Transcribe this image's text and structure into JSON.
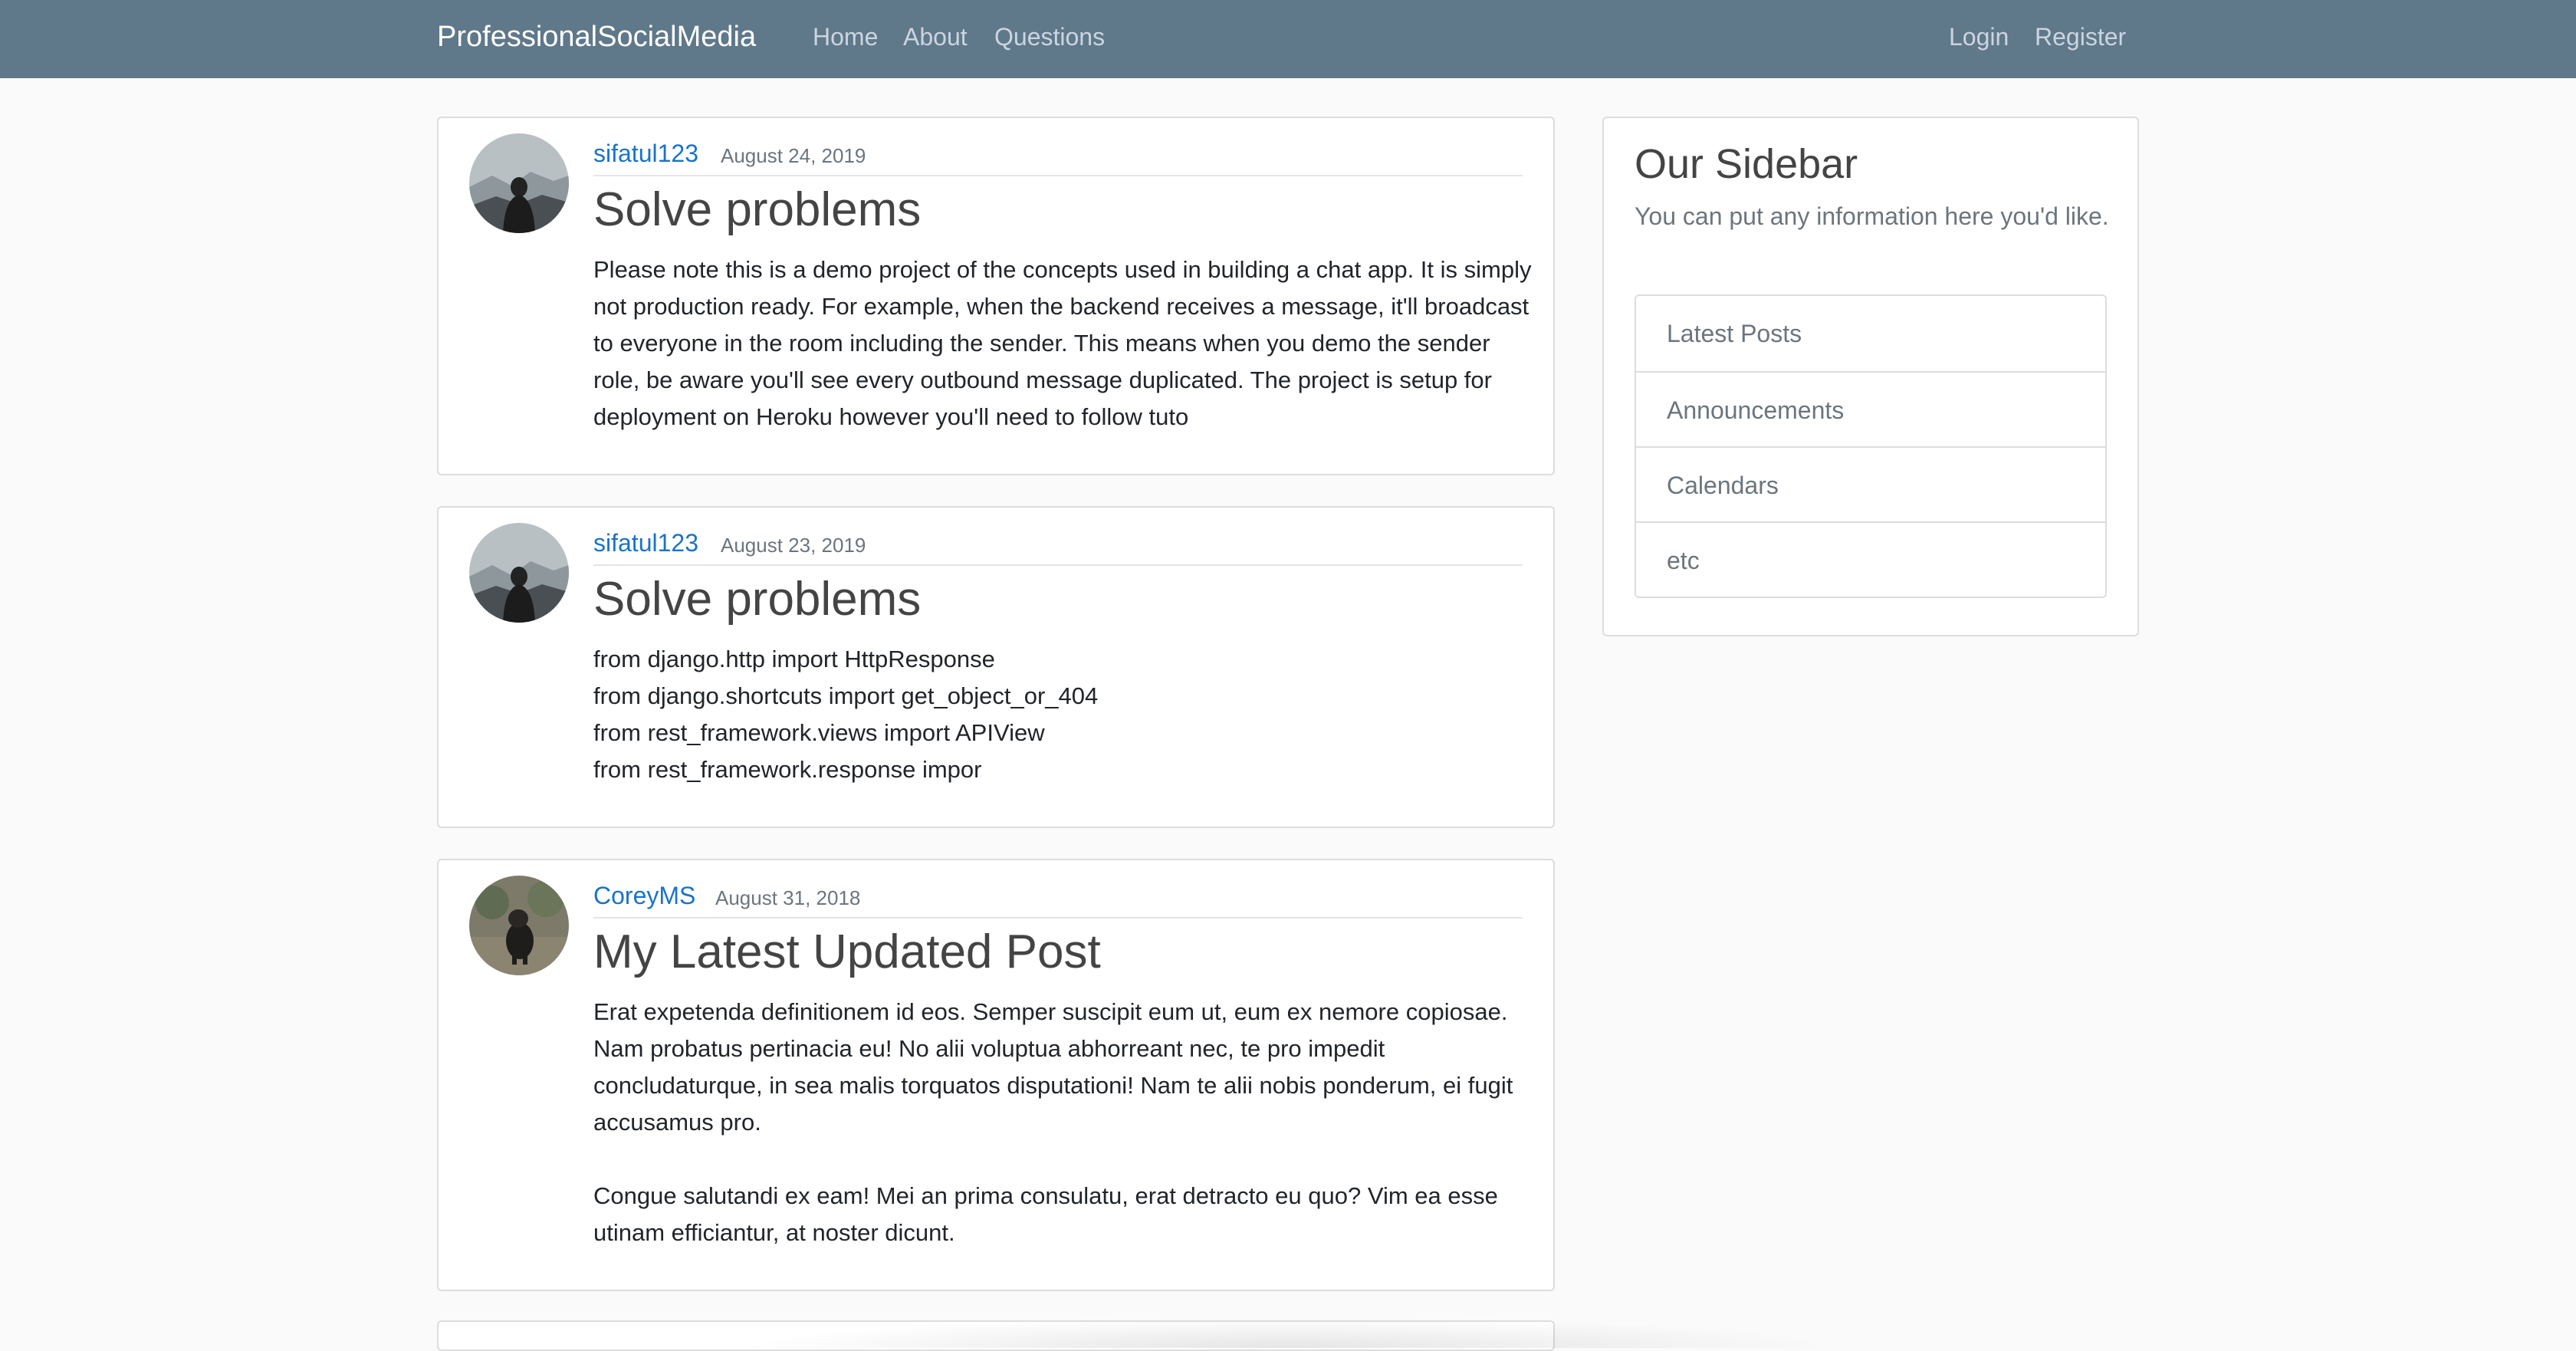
{
  "navbar": {
    "brand": "ProfessionalSocialMedia",
    "links": [
      "Home",
      "About",
      "Questions"
    ],
    "auth": [
      "Login",
      "Register"
    ]
  },
  "posts": [
    {
      "author": "sifatul123",
      "date": "August 24, 2019",
      "title": "Solve problems",
      "body": "Please note this is a demo project of the concepts used in building a chat app. It is simply not production ready. For example, when the backend receives a message, it'll broadcast to everyone in the room including the sender. This means when you demo the sender role, be aware you'll see every outbound message duplicated. The project is setup for deployment on Heroku however you'll need to follow tuto",
      "avatar": "mountain-silhouette-avatar"
    },
    {
      "author": "sifatul123",
      "date": "August 23, 2019",
      "title": "Solve problems",
      "body": "from django.http import HttpResponse\nfrom django.shortcuts import get_object_or_404\nfrom rest_framework.views import APIView\nfrom rest_framework.response impor",
      "avatar": "mountain-silhouette-avatar"
    },
    {
      "author": "CoreyMS",
      "date": "August 31, 2018",
      "title": "My Latest Updated Post",
      "body": "Erat expetenda definitionem id eos. Semper suscipit eum ut, eum ex nemore copiosae. Nam probatus pertinacia eu! No alii voluptua abhorreant nec, te pro impedit concludaturque, in sea malis torquatos disputationi! Nam te alii nobis ponderum, ei fugit accusamus pro.\n\nCongue salutandi ex eam! Mei an prima consulatu, erat detracto eu quo? Vim ea esse utinam efficiantur, at noster dicunt.",
      "avatar": "dog-photo-avatar"
    }
  ],
  "sidebar": {
    "title": "Our Sidebar",
    "description": "You can put any information here you'd like.",
    "items": [
      "Latest Posts",
      "Announcements",
      "Calendars",
      "etc"
    ]
  },
  "colors": {
    "navbar": "#5f788a",
    "link": "#1a73c8",
    "background": "#fafafa"
  }
}
